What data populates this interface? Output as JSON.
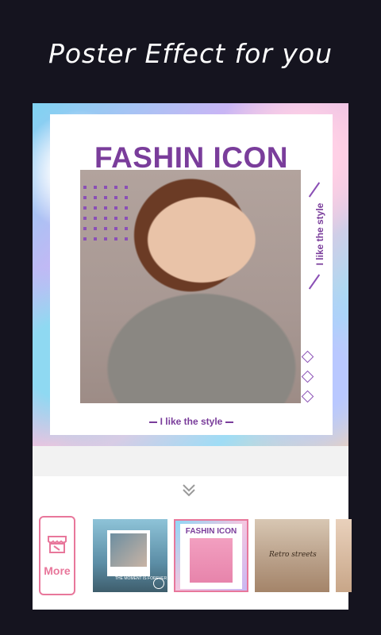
{
  "header": {
    "headline": "Poster Effect for you"
  },
  "poster": {
    "title": "FASHIN ICON",
    "vertical_tagline": "I like the style",
    "bottom_tagline": "I like the style"
  },
  "panel": {
    "more_label": "More",
    "templates": [
      {
        "name": "polaroid-template",
        "caption": "THE MOMENT IS FOREVER"
      },
      {
        "name": "fashion-icon-template",
        "title": "FASHIN ICON",
        "selected": true
      },
      {
        "name": "retro-streets-template",
        "caption": "Retro streets"
      },
      {
        "name": "partial-template"
      }
    ]
  },
  "colors": {
    "background": "#15141f",
    "accent_pink": "#e8779b",
    "poster_purple": "#7a3d9b"
  },
  "icons": {
    "collapse": "chevron-double-down-icon",
    "more": "store-icon",
    "download": "download-icon"
  }
}
